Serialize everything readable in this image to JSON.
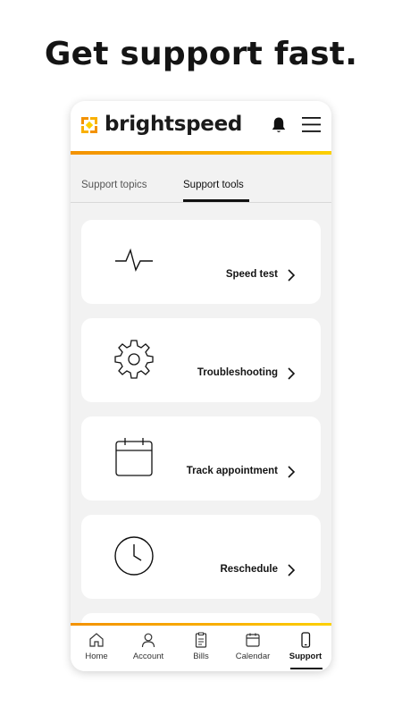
{
  "headline": "Get support fast.",
  "app": {
    "brand": "brightspeed",
    "accent_colors": [
      "#f39200",
      "#fcd000"
    ]
  },
  "header_icons": [
    "notifications-bell-icon",
    "hamburger-menu-icon"
  ],
  "tabs": [
    {
      "label": "Support topics",
      "active": false
    },
    {
      "label": "Support tools",
      "active": true
    }
  ],
  "tools": [
    {
      "label": "Speed test",
      "icon": "pulse-icon"
    },
    {
      "label": "Troubleshooting",
      "icon": "gear-icon"
    },
    {
      "label": "Track appointment",
      "icon": "calendar-icon"
    },
    {
      "label": "Reschedule",
      "icon": "clock-icon"
    }
  ],
  "bottom_nav": [
    {
      "label": "Home",
      "icon": "home-icon",
      "active": false
    },
    {
      "label": "Account",
      "icon": "person-icon",
      "active": false
    },
    {
      "label": "Bills",
      "icon": "bill-icon",
      "active": false
    },
    {
      "label": "Calendar",
      "icon": "calendar-icon",
      "active": false
    },
    {
      "label": "Support",
      "icon": "phone-icon",
      "active": true
    }
  ]
}
